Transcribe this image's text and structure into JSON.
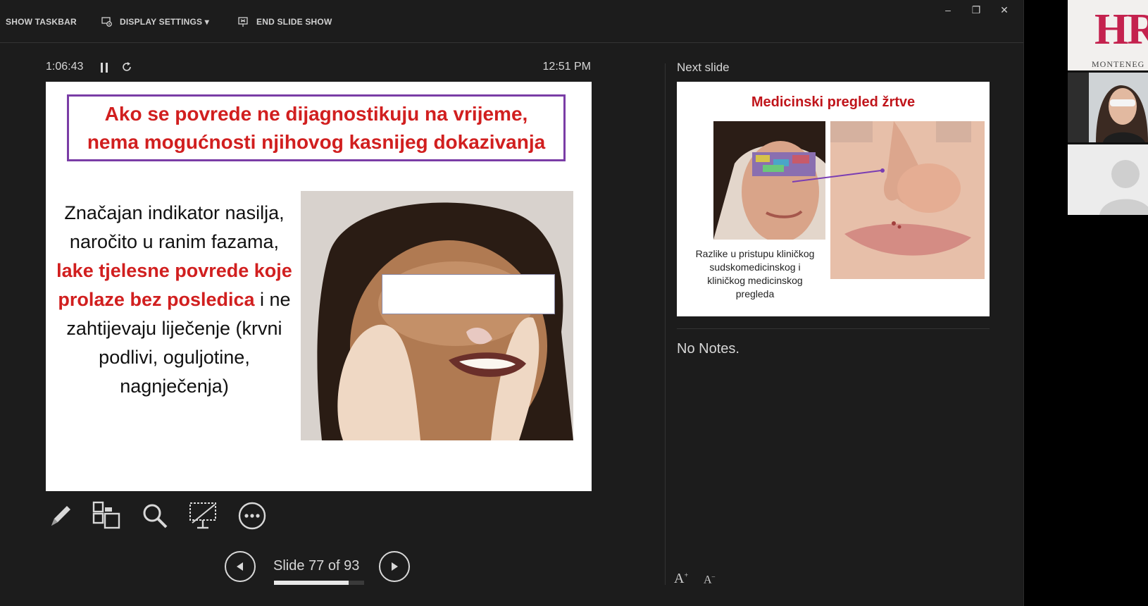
{
  "toolbar": {
    "show_taskbar": "SHOW TASKBAR",
    "display_settings": "DISPLAY SETTINGS ▾",
    "end_slide_show": "END SLIDE SHOW"
  },
  "window_controls": {
    "minimize": "–",
    "restore": "❐",
    "close": "✕"
  },
  "timer": {
    "elapsed": "1:06:43",
    "clock": "12:51 PM"
  },
  "current_slide": {
    "title": "Ako se povrede ne dijagnostikuju na vrijeme,\nnema mogućnosti njihovog kasnijeg dokazivanja",
    "body_part1": "Značajan indikator nasilja, naročito u ranim fazama, ",
    "body_highlight": "lake tjelesne povrede koje prolaze bez posledica",
    "body_part2": " i ne zahtijevaju liječenje (krvni podlivi, oguljotine, nagnječenja)"
  },
  "navigation": {
    "slide_counter": "Slide 77 of 93",
    "current": 77,
    "total": 93,
    "progress_percent": 82.8
  },
  "next_slide": {
    "label": "Next slide",
    "title": "Medicinski pregled žrtve",
    "caption": "Razlike u pristupu kliničkog\nsudskomedicinskog i\nkliničkog medicinskog\npregleda"
  },
  "notes": {
    "text": "No Notes."
  },
  "font_buttons": {
    "increase": "A",
    "decrease": "A"
  },
  "video_strip": {
    "logo_text": "HR",
    "logo_sub": "MONTENEG"
  },
  "icons": {
    "tools": [
      "pen-icon",
      "see-all-slides-icon",
      "zoom-icon",
      "black-screen-icon",
      "more-options-icon"
    ]
  },
  "colors": {
    "accent_red": "#d11f1f",
    "title_border": "#7a3da6",
    "background": "#1c1c1c"
  }
}
